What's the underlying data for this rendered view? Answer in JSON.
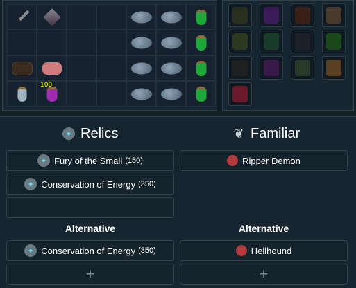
{
  "inventory": {
    "rows": [
      [
        "sword",
        "crystal",
        "",
        "",
        "shark",
        "shark",
        "potion-green"
      ],
      [
        "",
        "",
        "",
        "",
        "shark",
        "shark",
        "potion-green"
      ],
      [
        "pouch",
        "pink-item",
        "",
        "",
        "shark",
        "shark",
        "potion-green"
      ],
      [
        "potion-clear",
        "potion-purple",
        "",
        "",
        "shark",
        "shark",
        "potion-green"
      ]
    ],
    "quantities": {
      "3-1": "100"
    }
  },
  "equipment": {
    "slots": [
      {
        "icon": "helmet-icon",
        "color": "#2a3020"
      },
      {
        "icon": "cape-icon",
        "color": "#3a1a5a"
      },
      {
        "icon": "amulet-icon",
        "color": "#3a2018"
      },
      {
        "icon": "weapon-icon",
        "color": "#4a3a2e"
      },
      {
        "icon": "body-icon",
        "color": "#2a3a20"
      },
      {
        "icon": "arrow-icon",
        "color": "#1a3a2a"
      },
      {
        "icon": "legs-icon",
        "color": "#1c2024"
      },
      {
        "icon": "gloves-icon",
        "color": "#1a4a1a"
      },
      {
        "icon": "boots-icon",
        "color": "#202020"
      },
      {
        "icon": "quiver-icon",
        "color": "#3a1a4a"
      },
      {
        "icon": "ring-icon",
        "color": "#2a3a2a"
      },
      {
        "icon": "shield-icon",
        "color": "#5a4020"
      },
      {
        "icon": "pouch-icon",
        "color": "#6a1a2a"
      }
    ]
  },
  "relics": {
    "title": "Relics",
    "items": [
      {
        "name": "Fury of the Small",
        "num": "(150)"
      },
      {
        "name": "Conservation of Energy",
        "num": "(350)"
      },
      {
        "name": "",
        "num": ""
      }
    ],
    "alternative_label": "Alternative",
    "alternatives": [
      {
        "name": "Conservation of Energy",
        "num": "(350)"
      }
    ],
    "add_label": "+"
  },
  "familiar": {
    "title": "Familiar",
    "item": {
      "name": "Ripper Demon"
    },
    "alternative_label": "Alternative",
    "alternative": {
      "name": "Hellhound"
    },
    "add_label": "+"
  }
}
